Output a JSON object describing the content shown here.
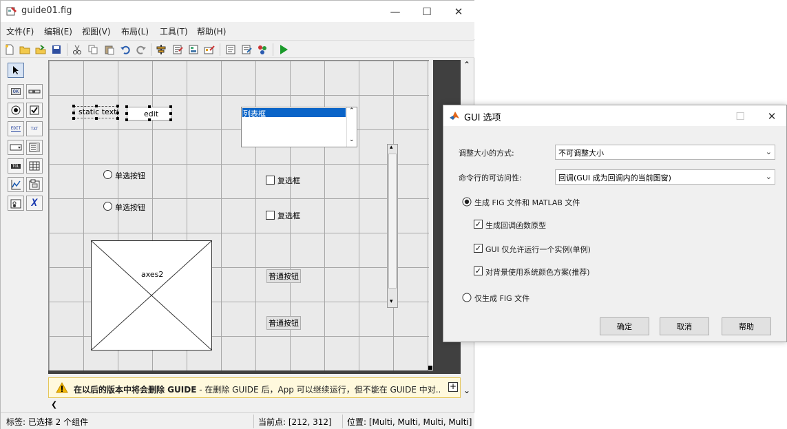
{
  "window": {
    "title": "guide01.fig",
    "minimize": "—",
    "maximize": "☐",
    "close": "✕"
  },
  "menu": [
    "文件(F)",
    "编辑(E)",
    "视图(V)",
    "布局(L)",
    "工具(T)",
    "帮助(H)"
  ],
  "toolbar": {
    "icons": [
      "new-file-icon",
      "open-folder-icon",
      "save-as-icon",
      "save-icon",
      "cut-icon",
      "copy-icon",
      "paste-icon",
      "undo-icon",
      "redo-icon",
      "align-icon",
      "menu-editor-icon",
      "tab-order-icon",
      "toolbar-editor-icon",
      "editor-icon",
      "property-inspector-icon",
      "object-browser-icon",
      "run-icon"
    ]
  },
  "palette": {
    "items": [
      {
        "icon": "select-arrow-icon",
        "label": "↖"
      },
      {
        "icon": "pushbutton-tool-icon",
        "label": "OK"
      },
      {
        "icon": "slider-tool-icon",
        "label": "▭"
      },
      {
        "icon": "radio-tool-icon",
        "label": "◉"
      },
      {
        "icon": "checkbox-tool-icon",
        "label": "☑"
      },
      {
        "icon": "edit-tool-icon",
        "label": "EDIT"
      },
      {
        "icon": "text-tool-icon",
        "label": "TXT"
      },
      {
        "icon": "popup-tool-icon",
        "label": "▭▾"
      },
      {
        "icon": "listbox-tool-icon",
        "label": "≡"
      },
      {
        "icon": "toggle-tool-icon",
        "label": "TGL"
      },
      {
        "icon": "table-tool-icon",
        "label": "▦"
      },
      {
        "icon": "axes-tool-icon",
        "label": "📈"
      },
      {
        "icon": "panel-tool-icon",
        "label": "▣"
      },
      {
        "icon": "buttongroup-tool-icon",
        "label": "◘"
      },
      {
        "icon": "activex-tool-icon",
        "label": "X"
      }
    ]
  },
  "canvas": {
    "static_text": "static text",
    "edit": "edit",
    "listbox_item": "列表框",
    "radio1": "单选按钮",
    "radio2": "单选按钮",
    "check1": "复选框",
    "check2": "复选框",
    "axes_label": "axes2",
    "pushbutton1": "普通按钮",
    "pushbutton2": "普通按钮"
  },
  "warning": {
    "bold": "在以后的版本中将会删除 GUIDE",
    "text": " - 在删除 GUIDE 后，App 可以继续运行，但不能在 GUIDE 中对..."
  },
  "status": {
    "tag": "标签: 已选择 2 个组件",
    "current_point": "当前点:   [212, 312]",
    "position": "位置: [Multi, Multi, Multi, Multi]"
  },
  "dialog": {
    "title": "GUI 选项",
    "resize_label": "调整大小的方式:",
    "resize_value": "不可调整大小",
    "cmdline_label": "命令行的可访问性:",
    "cmdline_value": "回调(GUI 成为回调内的当前图窗)",
    "opt_fig_mfile": "生成 FIG 文件和 MATLAB 文件",
    "cb_prototypes": "生成回调函数原型",
    "cb_singleton": "GUI 仅允许运行一个实例(单例)",
    "cb_colors": "对背景使用系统颜色方案(推荐)",
    "opt_fig_only": "仅生成 FIG 文件",
    "ok": "确定",
    "cancel": "取消",
    "help": "帮助"
  }
}
